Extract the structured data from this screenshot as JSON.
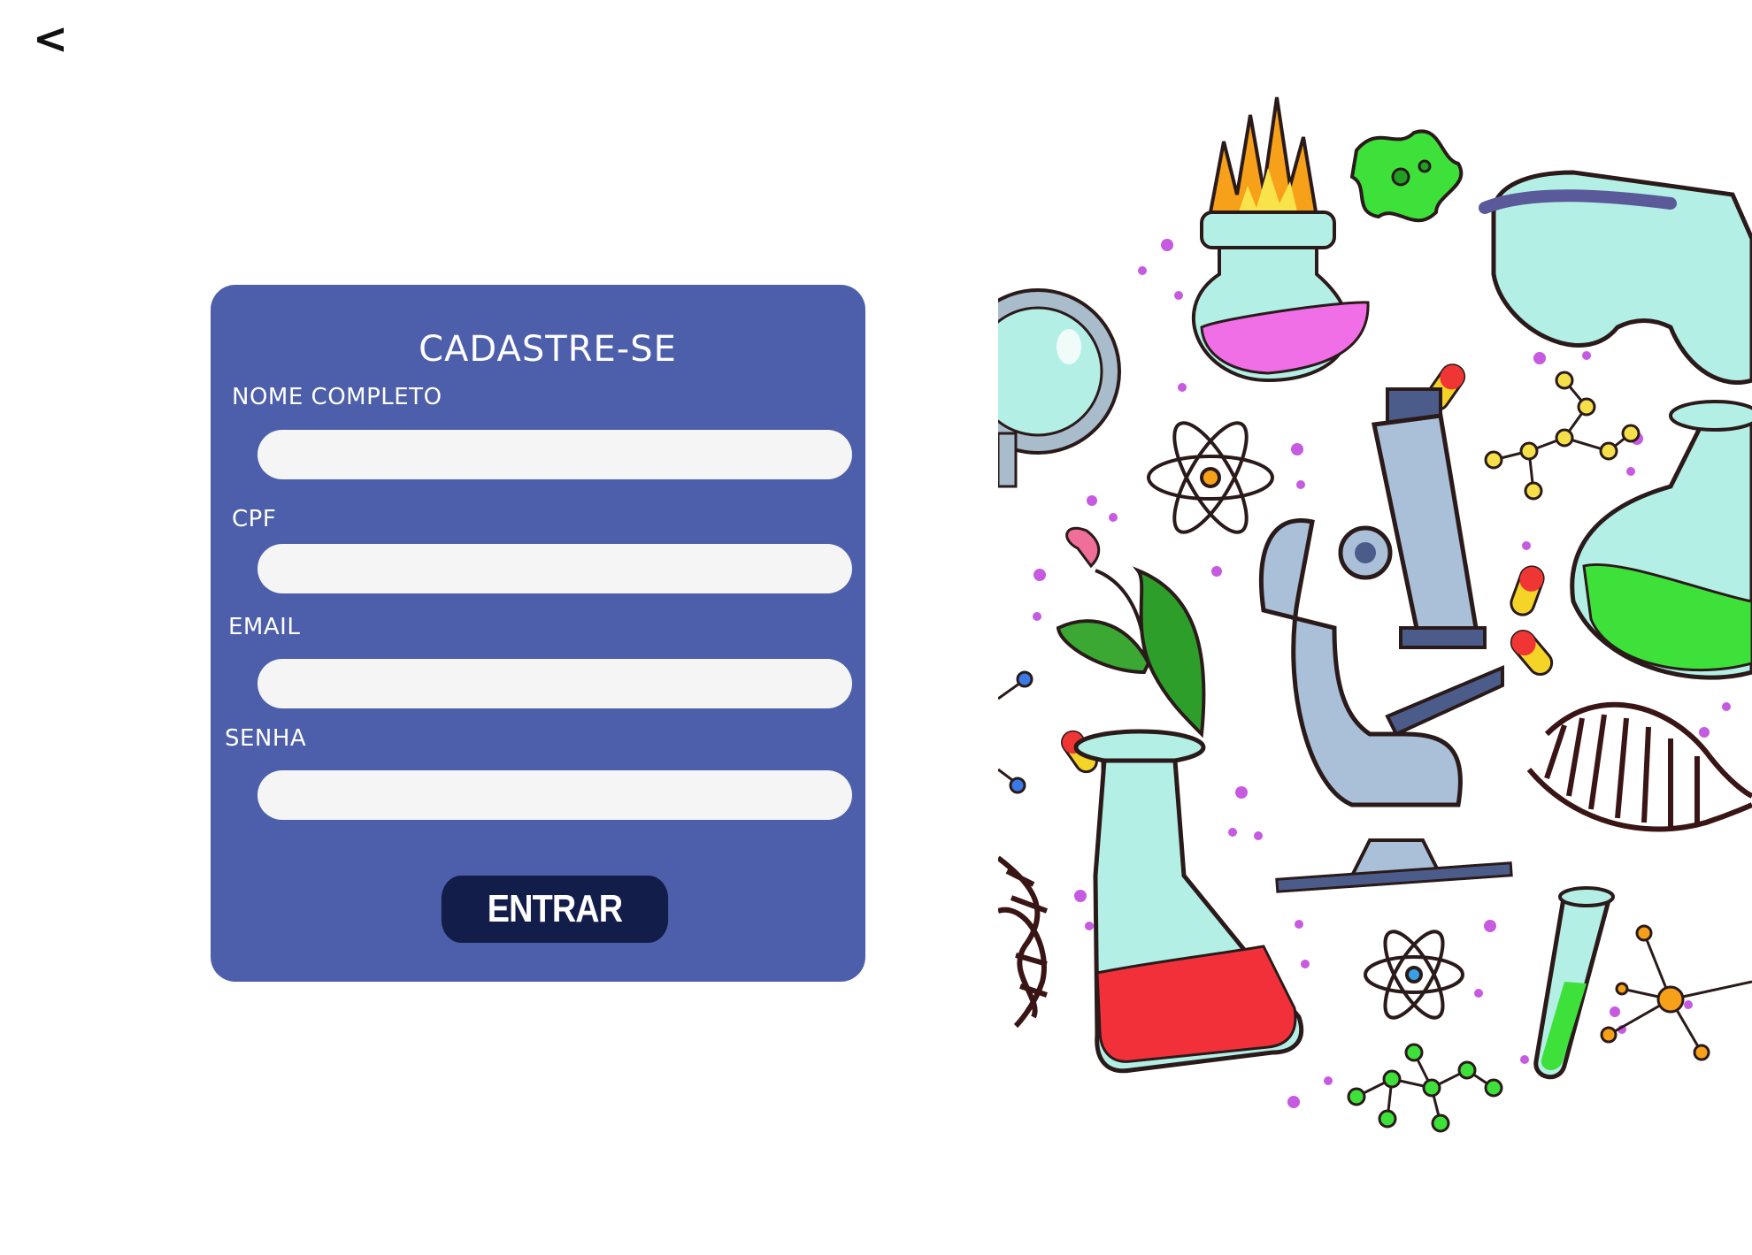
{
  "header": {
    "back_label": "<"
  },
  "form": {
    "title": "CADASTRE-SE",
    "fields": [
      {
        "label": "NOME COMPLETO",
        "value": "",
        "placeholder": ""
      },
      {
        "label": "CPF",
        "value": "",
        "placeholder": ""
      },
      {
        "label": "EMAIL",
        "value": "",
        "placeholder": ""
      },
      {
        "label": "SENHA",
        "value": "",
        "placeholder": ""
      }
    ],
    "submit_label": "ENTRAR"
  },
  "colors": {
    "card": "#4d5faa",
    "input": "#f5f5f5",
    "button": "#121d4a",
    "page": "#ffffff"
  },
  "illustration": {
    "icons": [
      "flame-icon",
      "flask-icon",
      "bacteria-icon",
      "goggles-icon",
      "magnifier-icon",
      "atom-icon",
      "molecule-icon",
      "microscope-icon",
      "leaf-icon",
      "capsule-icon",
      "dna-icon",
      "erlenmeyer-flask-icon",
      "test-tube-icon",
      "round-flask-icon"
    ]
  }
}
